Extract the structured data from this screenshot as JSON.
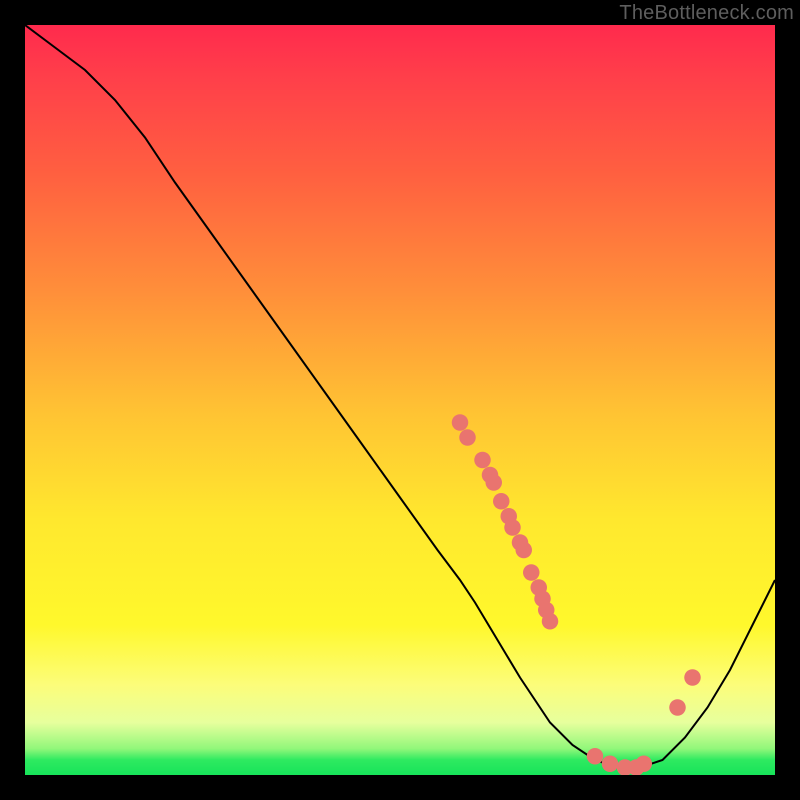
{
  "watermark": "TheBottleneck.com",
  "chart_data": {
    "type": "line",
    "title": "",
    "xlabel": "",
    "ylabel": "",
    "xlim": [
      0,
      100
    ],
    "ylim": [
      0,
      100
    ],
    "grid": false,
    "legend": false,
    "gradient_note": "background vertical gradient red(top)→yellow(mid)→green(bottom) implies lower y = better",
    "series": [
      {
        "name": "bottleneck-curve",
        "x": [
          0,
          4,
          8,
          12,
          16,
          20,
          25,
          30,
          35,
          40,
          45,
          50,
          55,
          58,
          60,
          63,
          66,
          70,
          73,
          76,
          79,
          82,
          85,
          88,
          91,
          94,
          97,
          100
        ],
        "y": [
          100,
          97,
          94,
          90,
          85,
          79,
          72,
          65,
          58,
          51,
          44,
          37,
          30,
          26,
          23,
          18,
          13,
          7,
          4,
          2,
          1,
          1,
          2,
          5,
          9,
          14,
          20,
          26
        ]
      }
    ],
    "markers": {
      "name": "highlight-dots",
      "color": "#e9746f",
      "points": [
        {
          "x": 58,
          "y": 47
        },
        {
          "x": 59,
          "y": 45
        },
        {
          "x": 61,
          "y": 42
        },
        {
          "x": 62,
          "y": 40
        },
        {
          "x": 62.5,
          "y": 39
        },
        {
          "x": 63.5,
          "y": 36.5
        },
        {
          "x": 64.5,
          "y": 34.5
        },
        {
          "x": 65,
          "y": 33
        },
        {
          "x": 66,
          "y": 31
        },
        {
          "x": 66.5,
          "y": 30
        },
        {
          "x": 67.5,
          "y": 27
        },
        {
          "x": 68.5,
          "y": 25
        },
        {
          "x": 69,
          "y": 23.5
        },
        {
          "x": 69.5,
          "y": 22
        },
        {
          "x": 70,
          "y": 20.5
        },
        {
          "x": 76,
          "y": 2.5
        },
        {
          "x": 78,
          "y": 1.5
        },
        {
          "x": 80,
          "y": 1
        },
        {
          "x": 81.5,
          "y": 1
        },
        {
          "x": 82.5,
          "y": 1.5
        },
        {
          "x": 87,
          "y": 9
        },
        {
          "x": 89,
          "y": 13
        }
      ]
    }
  }
}
